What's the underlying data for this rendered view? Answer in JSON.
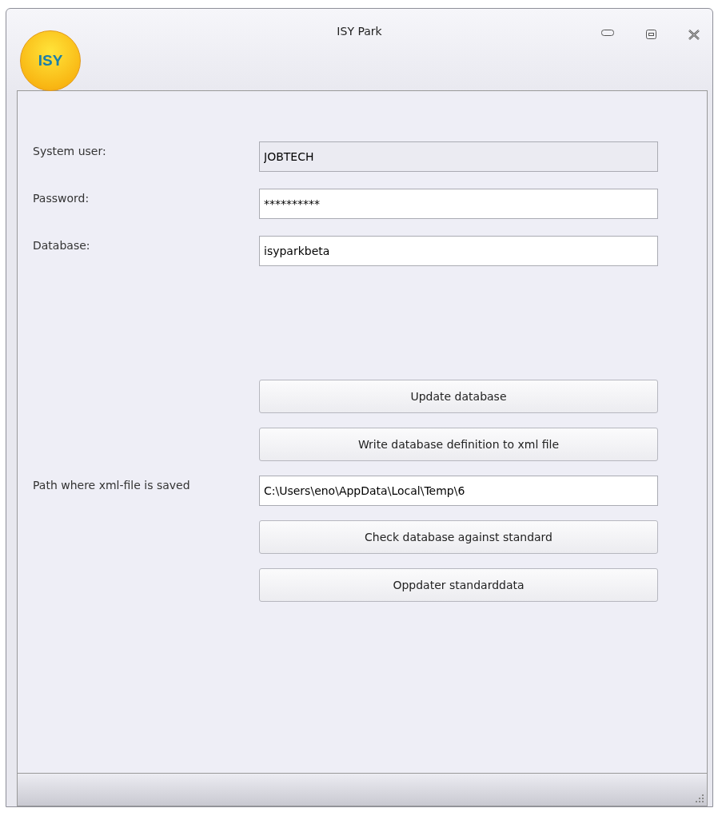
{
  "window": {
    "title": "ISY Park",
    "logo": "ISY"
  },
  "credentials": [
    {
      "label": "System user:",
      "value": "JOBTECH",
      "disabled": true
    },
    {
      "label": "Password:",
      "value": "**********",
      "disabled": false
    },
    {
      "label": "Database:",
      "value": "isyparkbeta",
      "disabled": false
    }
  ],
  "actions": [
    {
      "kind": "button",
      "text": "Update database"
    },
    {
      "kind": "button",
      "text": "Write database definition to xml file"
    },
    {
      "kind": "field",
      "label": "Path where xml-file is saved",
      "value": "C:\\Users\\eno\\AppData\\Local\\Temp\\6"
    },
    {
      "kind": "button",
      "text": "Check database against standard"
    },
    {
      "kind": "button",
      "text": "Oppdater standarddata"
    }
  ]
}
